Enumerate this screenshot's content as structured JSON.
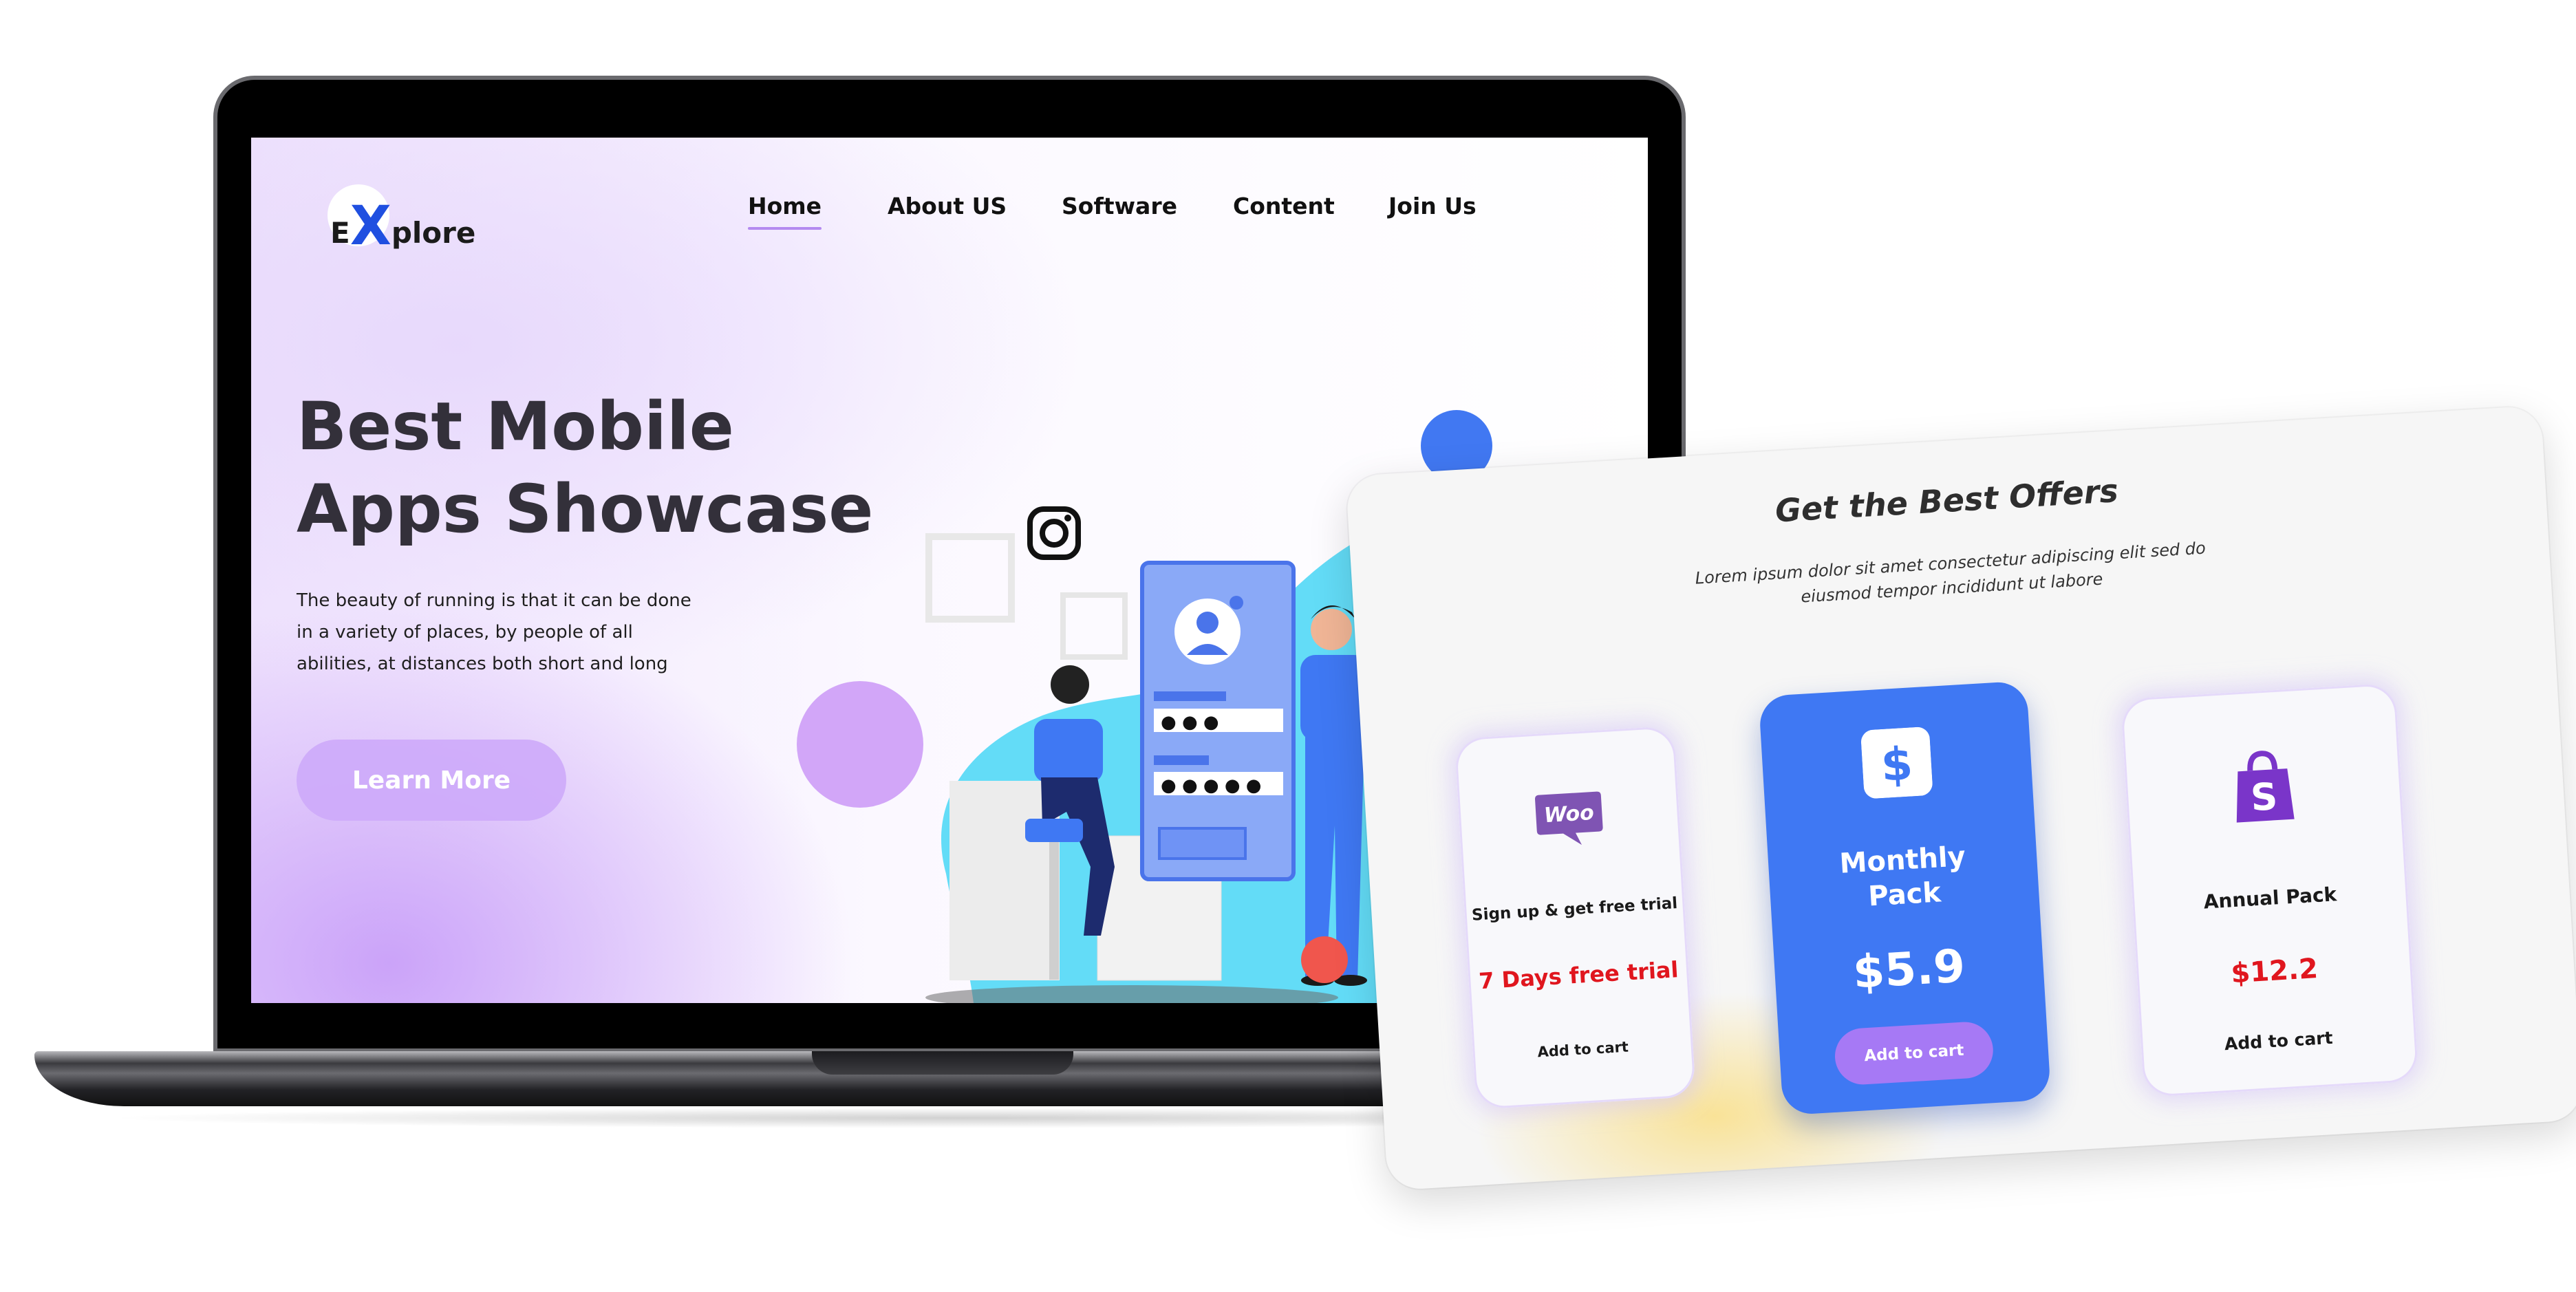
{
  "site": {
    "logo": {
      "first": "E",
      "x": "X",
      "rest": "plore"
    },
    "nav": [
      {
        "label": "Home",
        "active": true
      },
      {
        "label": "About US",
        "active": false
      },
      {
        "label": "Software",
        "active": false
      },
      {
        "label": "Content",
        "active": false
      },
      {
        "label": "Join Us",
        "active": false
      }
    ],
    "hero": {
      "title_line1": "Best Mobile",
      "title_line2": "Apps Showcase",
      "description": "The beauty of running is that it can be done in a variety of places, by people of all abilities, at distances both short and long",
      "cta": "Learn More"
    },
    "illustration": {
      "password_mask_1": "● ● ●",
      "password_mask_2": "● ● ● ● ●"
    }
  },
  "offers": {
    "title": "Get the Best Offers",
    "subtitle": "Lorem ipsum dolor sit amet consectetur adipiscing elit sed do eiusmod tempor incididunt ut labore",
    "plans": [
      {
        "icon": "woo-icon",
        "icon_text": "Woo",
        "name": "Sign up & get free trial",
        "price": "7 Days free trial",
        "cart": "Add to cart"
      },
      {
        "icon": "dollar-icon",
        "icon_text": "$",
        "name": "Monthly Pack",
        "price": "$5.9",
        "cart": "Add to cart"
      },
      {
        "icon": "shopping-bag-icon",
        "icon_text": "S",
        "name": "Annual Pack",
        "price": "$12.2",
        "cart": "Add to cart"
      }
    ]
  },
  "colors": {
    "accent_blue": "#3f78f3",
    "accent_purple": "#a679f5",
    "price_red": "#e0161e",
    "woo_purple": "#7f54b3",
    "shopify_purple": "#7a35c9"
  }
}
